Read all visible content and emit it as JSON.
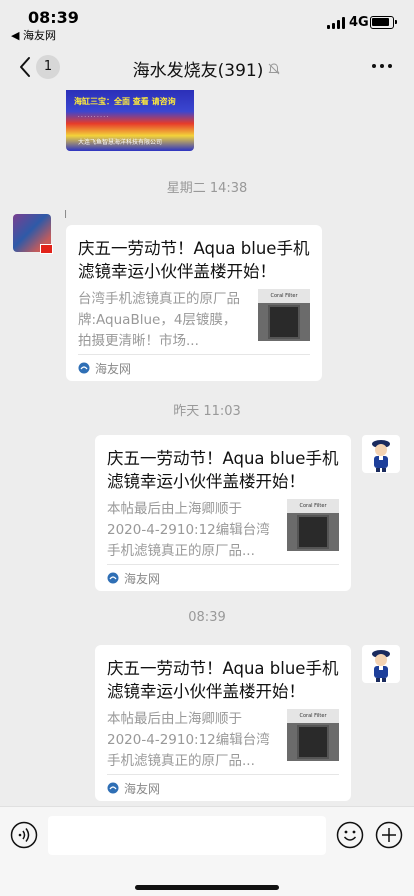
{
  "status_bar": {
    "time": "08:39",
    "back_app": "◀ 海友网",
    "network": "4G"
  },
  "nav": {
    "unread_count": "1",
    "title": "海水发烧友(391)",
    "mute_icon": "mute-bell-icon",
    "more_icon": "more-dots-icon"
  },
  "chat": {
    "banner": {
      "headline": "海缸三宝：全面 查看 请咨询",
      "line": "大连飞鱼智慧海洋科技有限公司"
    },
    "messages": [
      {
        "timestamp": "星期二 14:38",
        "side": "left",
        "sender_name": "l",
        "card": {
          "title": "庆五一劳动节！Aqua blue手机滤镜幸运小伙伴盖楼开始！",
          "description": "台湾手机滤镜真正的原厂品牌:AquaBlue，4层镀膜，拍摄更清晰！市场...",
          "thumb_label": "Coral Filter",
          "source": "海友网"
        }
      },
      {
        "timestamp": "昨天 11:03",
        "side": "right",
        "card": {
          "title": "庆五一劳动节！Aqua blue手机滤镜幸运小伙伴盖楼开始！",
          "description": "本帖最后由上海卿顺于2020-4-2910:12编辑台湾手机滤镜真正的原厂品...",
          "thumb_label": "Coral Filter",
          "source": "海友网"
        }
      },
      {
        "timestamp": "08:39",
        "side": "right",
        "card": {
          "title": "庆五一劳动节！Aqua blue手机滤镜幸运小伙伴盖楼开始！",
          "description": "本帖最后由上海卿顺于2020-4-2910:12编辑台湾手机滤镜真正的原厂品...",
          "thumb_label": "Coral Filter",
          "source": "海友网"
        }
      }
    ]
  },
  "input_bar": {
    "voice_icon": "voice-icon",
    "emoji_icon": "emoji-icon",
    "plus_icon": "plus-icon"
  }
}
